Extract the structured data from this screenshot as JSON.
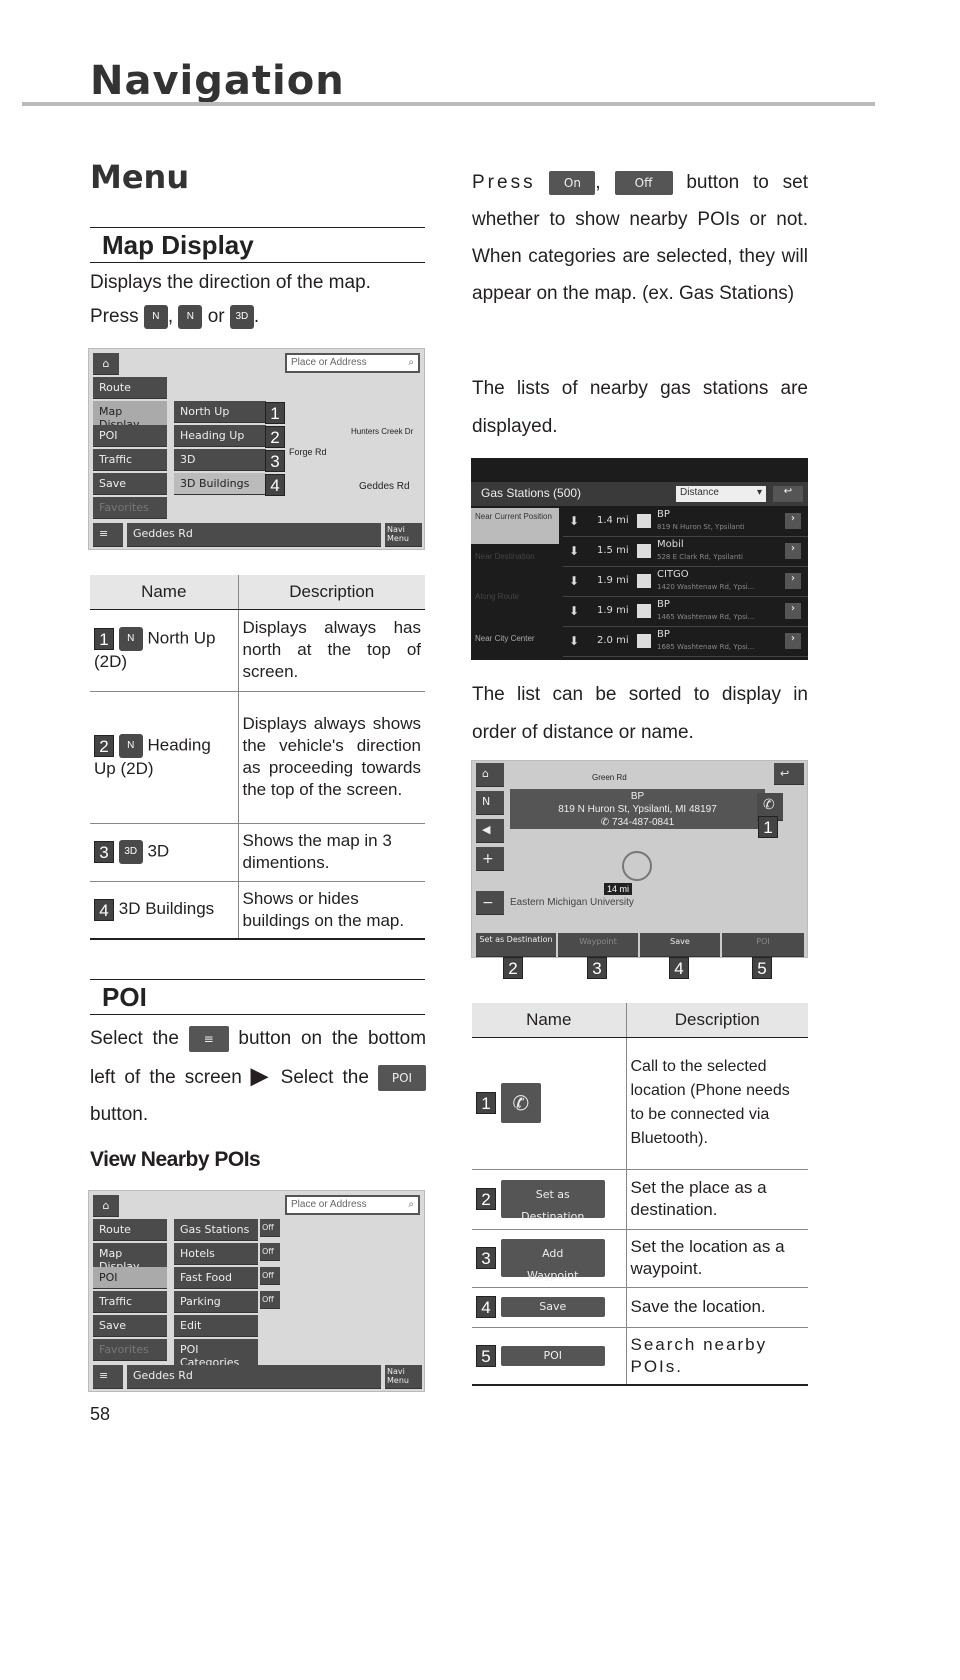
{
  "header": {
    "title": "Navigation"
  },
  "section": "Menu",
  "map_display": {
    "heading": "Map Display",
    "intro": "Displays the direction of the map.",
    "press": "Press",
    "comma": ",",
    "or": "or",
    "period": ".",
    "icons": [
      "N",
      "N",
      "3D"
    ],
    "screen": {
      "home": "home-icon",
      "search_placeholder": "Place or Address",
      "menu": [
        "Route",
        "Map Display",
        "POI",
        "Traffic",
        "Save",
        "Favorites"
      ],
      "submenu": [
        "North Up",
        "Heading Up",
        "3D",
        "3D Buildings"
      ],
      "streets": [
        "Hunters Creek Dr",
        "Forge Rd",
        "Geddes Rd"
      ],
      "bottom_street": "Geddes Rd",
      "navi_menu": "Navi Menu",
      "labels": [
        "1",
        "2",
        "3",
        "4"
      ]
    },
    "table": {
      "headers": [
        "Name",
        "Description"
      ],
      "rows": [
        {
          "num": "1",
          "name": "North Up (2D)",
          "desc": "Displays always has north at the top of screen."
        },
        {
          "num": "2",
          "name": "Heading Up (2D)",
          "desc": "Displays always shows the vehicle's direction as proceeding towards the top of the screen."
        },
        {
          "num": "3",
          "name": "3D",
          "desc": "Shows the map in 3 dimentions."
        },
        {
          "num": "4",
          "name": "3D Buildings",
          "desc": "Shows or hides buildings on the map."
        }
      ]
    }
  },
  "poi": {
    "heading": "POI",
    "text1": "Select the",
    "text2": "button on the bottom left of the screen",
    "text3": "Select the",
    "poi_btn": "POI",
    "text4": "button.",
    "sub": "View Nearby POIs",
    "screen": {
      "search_placeholder": "Place or Address",
      "menu": [
        "Route",
        "Map Display",
        "POI",
        "Traffic",
        "Save",
        "Favorites"
      ],
      "categories": [
        "Gas Stations",
        "Hotels",
        "Fast Food",
        "Parking",
        "Edit",
        "POI Categories"
      ],
      "toggle": "Off",
      "bottom_street": "Geddes Rd",
      "navi_menu": "Navi Menu"
    }
  },
  "right": {
    "press": "Press",
    "on": "On",
    "off": "Off",
    "press_rest": "button to set whether to show nearby POIs or not. When categories are selected, they will appear on the map. (ex. Gas Stations)",
    "lists_text": "The lists of nearby gas stations are displayed.",
    "gas": {
      "title": "Gas Stations (500)",
      "sort": "Distance",
      "left": [
        "Near Current Position",
        "Near Destination",
        "Along Route",
        "Near City Center"
      ],
      "rows": [
        {
          "dist": "1.4 mi",
          "name": "BP",
          "addr": "819 N Huron St, Ypsilanti"
        },
        {
          "dist": "1.5 mi",
          "name": "Mobil",
          "addr": "528 E Clark Rd, Ypsilanti"
        },
        {
          "dist": "1.9 mi",
          "name": "CITGO",
          "addr": "1420 Washtenaw Rd, Ypsi..."
        },
        {
          "dist": "1.9 mi",
          "name": "BP",
          "addr": "1465 Washtenaw Rd, Ypsi..."
        },
        {
          "dist": "2.0 mi",
          "name": "BP",
          "addr": "1685 Washtenaw Rd, Ypsi..."
        }
      ]
    },
    "sort_text": "The list can be sorted to display in order of distance or name.",
    "detail": {
      "name": "BP",
      "addr": "819 N Huron St, Ypsilanti, MI 48197",
      "phone": "734-487-0841",
      "street": "Green Rd",
      "place": "Eastern Michigan University",
      "dist": "14 mi",
      "buttons": [
        "Set as Destination",
        "Waypoint",
        "Save",
        "POI"
      ],
      "labels": [
        "1",
        "2",
        "3",
        "4",
        "5"
      ]
    },
    "table": {
      "headers": [
        "Name",
        "Description"
      ],
      "rows": [
        {
          "num": "1",
          "btn": "",
          "desc": "Call to the selected location (Phone needs to be connected via Bluetooth)."
        },
        {
          "num": "2",
          "btn": "Set as Destination",
          "desc": "Set the place as a destination."
        },
        {
          "num": "3",
          "btn": "Add Waypoint",
          "desc": "Set the location as a waypoint."
        },
        {
          "num": "4",
          "btn": "Save",
          "desc": "Save the location."
        },
        {
          "num": "5",
          "btn": "POI",
          "desc": "Search nearby POIs."
        }
      ]
    }
  },
  "page_number": "58"
}
